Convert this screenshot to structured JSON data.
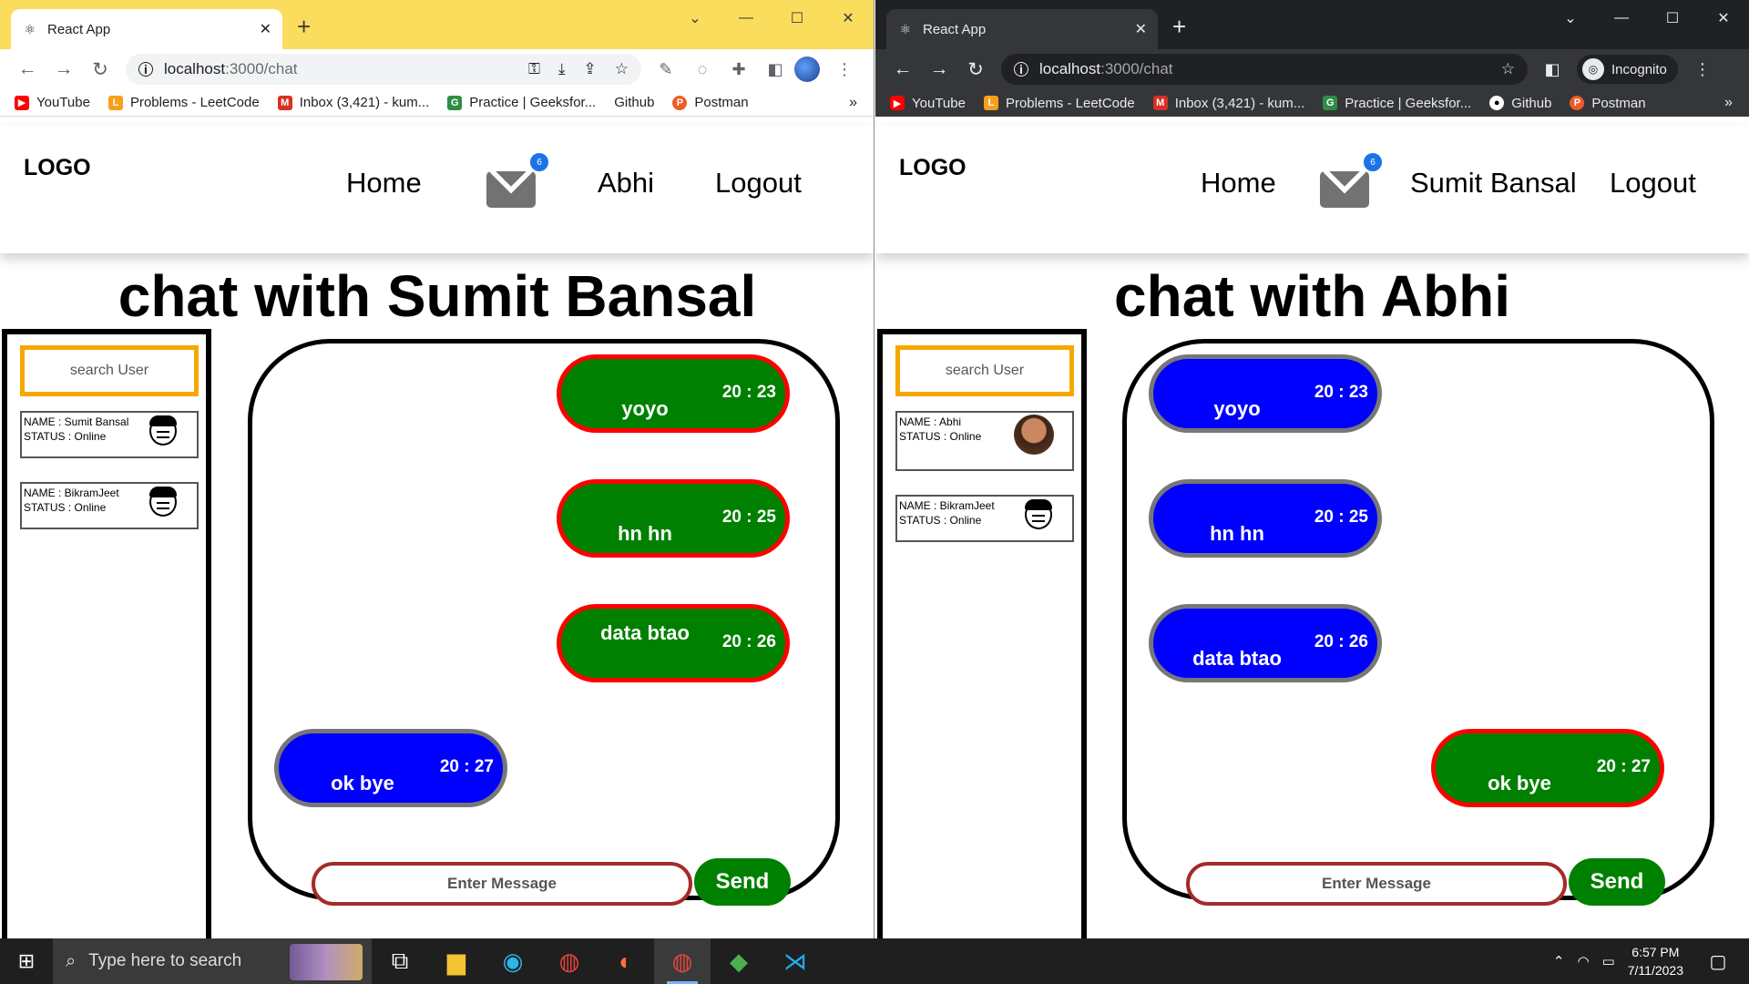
{
  "left": {
    "tab_title": "React App",
    "url_host": "localhost",
    "url_path": ":3000/chat",
    "bookmarks": [
      "YouTube",
      "Problems - LeetCode",
      "Inbox (3,421) - kum...",
      "Practice | Geeksfor...",
      "Github",
      "Postman"
    ],
    "logo": "LOGO",
    "nav": {
      "home": "Home",
      "user": "Abhi",
      "logout": "Logout",
      "badge": "6"
    },
    "title": "chat with Sumit Bansal",
    "search_placeholder": "search User",
    "users": [
      {
        "name": "NAME : Sumit Bansal",
        "status": "STATUS : Online"
      },
      {
        "name": "NAME : BikramJeet",
        "status": "STATUS : Online"
      }
    ],
    "messages": [
      {
        "text": "yoyo",
        "time": "20 : 23",
        "from": "me"
      },
      {
        "text": "hn hn",
        "time": "20 : 25",
        "from": "me"
      },
      {
        "text": "data btao",
        "time": "20 : 26",
        "from": "me"
      },
      {
        "text": "ok bye",
        "time": "20 : 27",
        "from": "them"
      }
    ],
    "input_placeholder": "Enter Message",
    "send": "Send"
  },
  "right": {
    "tab_title": "React App",
    "url_host": "localhost",
    "url_path": ":3000/chat",
    "incognito": "Incognito",
    "bookmarks": [
      "YouTube",
      "Problems - LeetCode",
      "Inbox (3,421) - kum...",
      "Practice | Geeksfor...",
      "Github",
      "Postman"
    ],
    "logo": "LOGO",
    "nav": {
      "home": "Home",
      "user": "Sumit Bansal",
      "logout": "Logout",
      "badge": "6"
    },
    "title": "chat with Abhi",
    "search_placeholder": "search User",
    "users": [
      {
        "name": "NAME : Abhi",
        "status": "STATUS : Online"
      },
      {
        "name": "NAME : BikramJeet",
        "status": "STATUS : Online"
      }
    ],
    "messages": [
      {
        "text": "yoyo",
        "time": "20 : 23",
        "from": "them"
      },
      {
        "text": "hn hn",
        "time": "20 : 25",
        "from": "them"
      },
      {
        "text": "data btao",
        "time": "20 : 26",
        "from": "them"
      },
      {
        "text": "ok bye",
        "time": "20 : 27",
        "from": "me"
      }
    ],
    "input_placeholder": "Enter Message",
    "send": "Send"
  },
  "taskbar": {
    "search_placeholder": "Type here to search",
    "time": "6:57 PM",
    "date": "7/11/2023"
  },
  "colors": {
    "sent_bubble": "#008000",
    "sent_border": "#ff0000",
    "received_bubble": "#0000ff",
    "received_border": "#777777",
    "search_border": "#f6a800",
    "send_button": "#008000",
    "left_window_frame": "#fbdd5e",
    "right_window_frame": "#202124"
  }
}
